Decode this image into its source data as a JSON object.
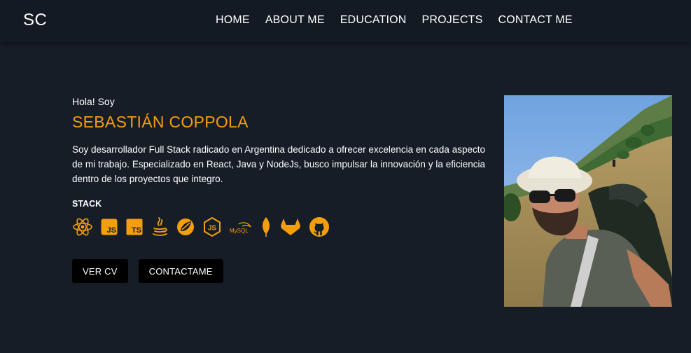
{
  "header": {
    "logo": "SC",
    "nav": [
      "HOME",
      "ABOUT ME",
      "EDUCATION",
      "PROJECTS",
      "CONTACT ME"
    ]
  },
  "hero": {
    "greeting": "Hola! Soy",
    "name": "SEBASTIÁN COPPOLA",
    "description": "Soy desarrollador Full Stack radicado en Argentina dedicado a ofrecer excelencia en cada aspecto de mi trabajo. Especializado en React, Java y NodeJs, busco impulsar la innovación y la eficiencia dentro de los proyectos que integro.",
    "stack_title": "STACK",
    "stack_icons": [
      "react-icon",
      "javascript-icon",
      "typescript-icon",
      "java-icon",
      "spring-icon",
      "nodejs-icon",
      "mysql-icon",
      "mongodb-icon",
      "gitlab-icon",
      "github-icon"
    ],
    "stack_labels": {
      "js": "JS",
      "ts": "TS",
      "node": "JS",
      "mysql": "MySQL"
    },
    "buttons": {
      "cv": "VER CV",
      "contact": "CONTACTAME"
    }
  },
  "colors": {
    "accent": "#f59e0b",
    "background": "#161d27",
    "header": "#141a23",
    "button": "#000000"
  }
}
